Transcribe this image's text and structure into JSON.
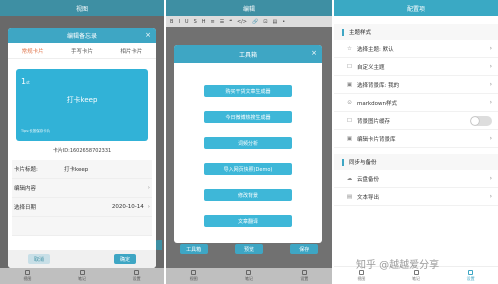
{
  "panel1": {
    "title": "视图",
    "modal": {
      "title": "编辑备忘录",
      "close": "×",
      "tabs": [
        "常规卡片",
        "手写卡片",
        "相片卡片"
      ],
      "card": {
        "day": "1",
        "day_suffix": "st",
        "title": "打卡keep",
        "tips": "Tips:长按保存卡片"
      },
      "card_id": "卡片ID:1602658702331",
      "fields": [
        {
          "label": "卡片标题:",
          "value": "打卡keep",
          "arrow": ""
        },
        {
          "label": "编辑内容",
          "value": "",
          "arrow": "›"
        },
        {
          "label": "选择日期",
          "value": "2020-10-14",
          "arrow": "›"
        },
        {
          "label": "",
          "value": "",
          "arrow": ""
        }
      ],
      "cancel": "取消",
      "ok": "确定"
    },
    "nav": [
      "视图",
      "笔记",
      "设置"
    ]
  },
  "panel2": {
    "title": "编辑",
    "toolbar": [
      "B",
      "I",
      "U",
      "S",
      "H",
      "≡",
      "☰",
      "❝",
      "</>",
      "🔗",
      "⊡",
      "▤",
      "•"
    ],
    "modal": {
      "title": "工具箱",
      "close": "×",
      "buttons": [
        "购买干货文章生成器",
        "今日微博热搜生成器",
        "词频分析",
        "导入网页快照(Demo)",
        "修改背景",
        "文章翻译"
      ]
    },
    "bottom_buttons": [
      "工具箱",
      "预览",
      "保存"
    ],
    "nav": [
      "视图",
      "笔记",
      "设置"
    ]
  },
  "panel3": {
    "title": "配置项",
    "sections": [
      {
        "title": "主题样式",
        "rows": [
          {
            "icon": "☆",
            "label": "选择主题: 默认",
            "control": "›"
          },
          {
            "icon": "☐",
            "label": "自定义主题",
            "control": "›"
          },
          {
            "icon": "▣",
            "label": "选择背景库: 我的",
            "control": "›"
          },
          {
            "icon": "⊙",
            "label": "markdown样式",
            "control": "›"
          },
          {
            "icon": "☐",
            "label": "背景图片缓存",
            "control": "toggle"
          },
          {
            "icon": "▣",
            "label": "编辑卡片背景库",
            "control": "›"
          }
        ]
      },
      {
        "title": "同步与备份",
        "rows": [
          {
            "icon": "☁",
            "label": "云盘备份",
            "control": "›"
          },
          {
            "icon": "▤",
            "label": "文本导出",
            "control": "›"
          }
        ]
      }
    ],
    "nav": [
      "视图",
      "笔记",
      "设置"
    ]
  },
  "watermark": "知乎 @越越爱分享"
}
